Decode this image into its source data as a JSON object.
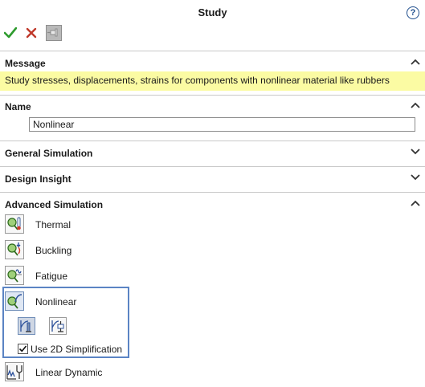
{
  "header": {
    "title": "Study",
    "help_icon": "question-circle-icon",
    "help_glyph": "?"
  },
  "toolbar": {
    "ok_icon": "checkmark-icon",
    "cancel_icon": "x-icon",
    "pin_icon": "pushpin-icon"
  },
  "sections": {
    "message": {
      "title": "Message",
      "text": "Study stresses, displacements, strains for components with nonlinear material like rubbers",
      "expanded": true
    },
    "name": {
      "title": "Name",
      "value": "Nonlinear",
      "expanded": true
    },
    "general_simulation": {
      "title": "General Simulation",
      "expanded": false
    },
    "design_insight": {
      "title": "Design Insight",
      "expanded": false
    },
    "advanced_simulation": {
      "title": "Advanced Simulation",
      "expanded": true,
      "items": [
        {
          "label": "Thermal",
          "icon": "thermal-study-icon"
        },
        {
          "label": "Buckling",
          "icon": "buckling-study-icon"
        },
        {
          "label": "Fatigue",
          "icon": "fatigue-study-icon"
        },
        {
          "label": "Nonlinear",
          "icon": "nonlinear-study-icon",
          "selected": true
        },
        {
          "label": "Linear Dynamic",
          "icon": "linear-dynamic-study-icon"
        }
      ],
      "nonlinear_options": {
        "sub_icons": [
          "nonlinear-static-icon",
          "nonlinear-dynamic-icon"
        ],
        "checkbox_label": "Use 2D Simplification",
        "checkbox_checked": true
      }
    }
  },
  "colors": {
    "message_bg": "#fbfba3",
    "highlight_border": "#5b84c4",
    "ok_green": "#2e9b2e",
    "cancel_red": "#c0392b"
  }
}
